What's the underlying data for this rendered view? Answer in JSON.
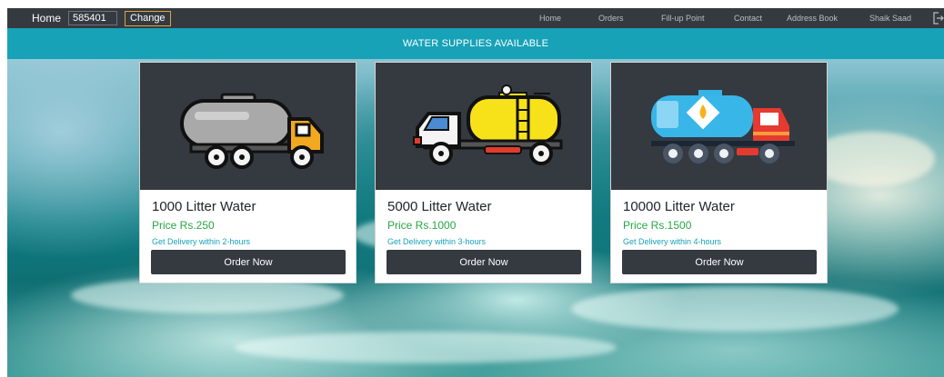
{
  "navbar": {
    "home_label": "Home",
    "pincode_value": "585401",
    "change_label": "Change",
    "links": [
      "Home",
      "Orders",
      "Fill-up Point",
      "Contact",
      "Address Book",
      "Shaik Saad"
    ],
    "logout_icon": "logout-icon"
  },
  "banner": {
    "text": "WATER SUPPLIES AVAILABLE"
  },
  "products": [
    {
      "title": "1000 Litter Water",
      "price": "Price Rs.250",
      "delivery": "Get Delivery within 2-hours",
      "button": "Order Now",
      "icon": "grey-tanker-truck-icon"
    },
    {
      "title": "5000 Litter Water",
      "price": "Price Rs.1000",
      "delivery": "Get Delivery within 3-hours",
      "button": "Order Now",
      "icon": "yellow-tanker-truck-icon"
    },
    {
      "title": "10000 Litter Water",
      "price": "Price Rs.1500",
      "delivery": "Get Delivery within 4-hours",
      "button": "Order Now",
      "icon": "blue-tanker-truck-icon"
    }
  ],
  "colors": {
    "navbar_bg": "#343a40",
    "banner_bg": "#17a2b8",
    "price_green": "#28a745",
    "delivery_teal": "#17a2b8",
    "button_dark": "#343a40"
  }
}
